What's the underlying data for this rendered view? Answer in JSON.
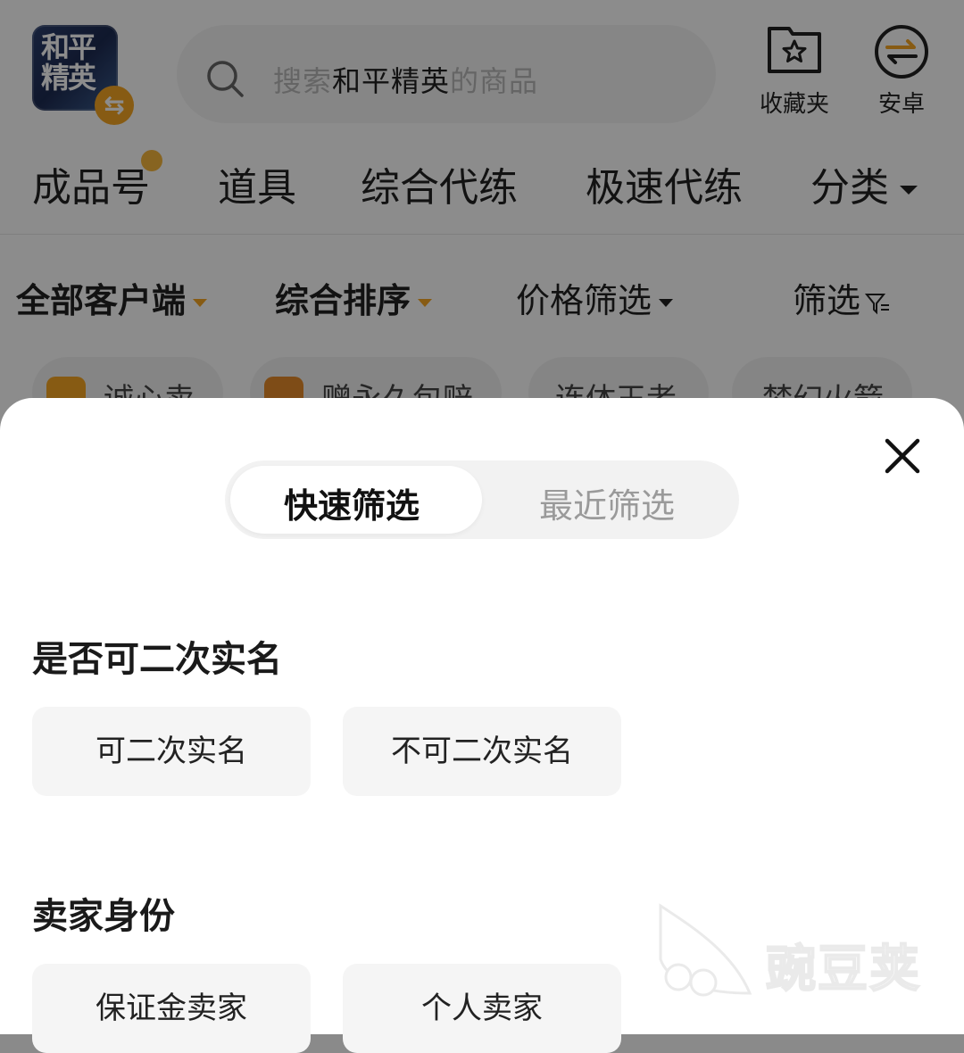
{
  "header": {
    "game_logo_text": "和平精英",
    "search": {
      "prefix": "搜索",
      "keyword": "和平精英",
      "suffix": "的商品"
    },
    "favorites_label": "收藏夹",
    "platform_label": "安卓"
  },
  "category_tabs": [
    "成品号",
    "道具",
    "综合代练",
    "极速代练",
    "分类"
  ],
  "filters": {
    "client": "全部客户端",
    "sort": "综合排序",
    "price": "价格筛选",
    "filter": "筛选"
  },
  "chips": [
    "诚心卖",
    "赠永久包赔",
    "连体王者",
    "梦幻火箭"
  ],
  "sheet": {
    "tabs": [
      "快速筛选",
      "最近筛选"
    ],
    "active_tab": "快速筛选",
    "sections": [
      {
        "title": "是否可二次实名",
        "options": [
          "可二次实名",
          "不可二次实名"
        ]
      },
      {
        "title": "卖家身份",
        "options": [
          "保证金卖家",
          "个人卖家"
        ]
      }
    ]
  },
  "watermark": "豌豆荚",
  "colors": {
    "accent": "#f6a623",
    "text": "#222222",
    "muted": "#9a9a9a",
    "chip_bg": "#f5f5f5"
  }
}
